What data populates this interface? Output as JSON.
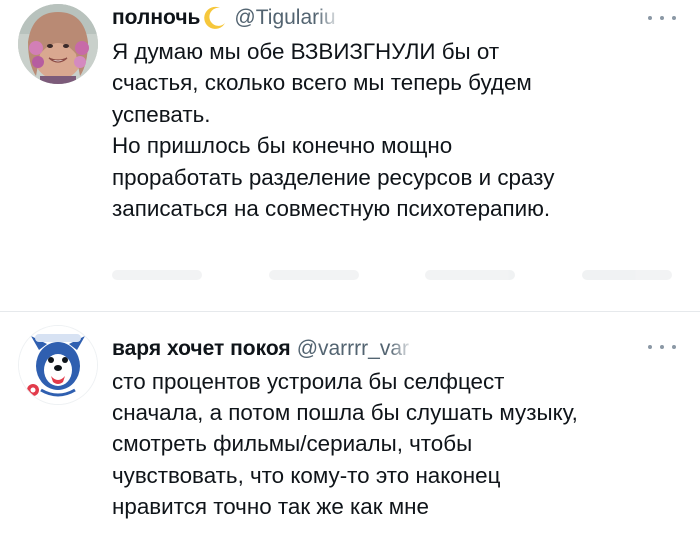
{
  "tweets": [
    {
      "display_name": "полночь",
      "handle": "@Tigulariu",
      "avatar_icon": "avatar-photo",
      "emoji": "crescent-moon",
      "lines": [
        "Я думаю мы обе ВЗВИЗГНУЛИ бы от",
        "счастья, сколько всего мы теперь будем",
        "успевать.",
        "Но пришлось бы конечно мощно",
        "проработать разделение ресурсов и сразу",
        "записаться на совместную психотерапию."
      ]
    },
    {
      "display_name": "варя хочет покоя",
      "handle": "@varrrr_var",
      "avatar_icon": "cartoon-dog-avatar",
      "lines": [
        "сто процентов устроила бы селфцест",
        "сначала, а потом пошла бы слушать музыку,",
        "смотреть фильмы/сериалы, чтобы",
        "чувствовать, что кому-то это наконец",
        "нравится точно так же как мне"
      ]
    }
  ],
  "colors": {
    "text": "#0f1419",
    "secondary": "#536471",
    "divider": "#e6e9ec"
  }
}
